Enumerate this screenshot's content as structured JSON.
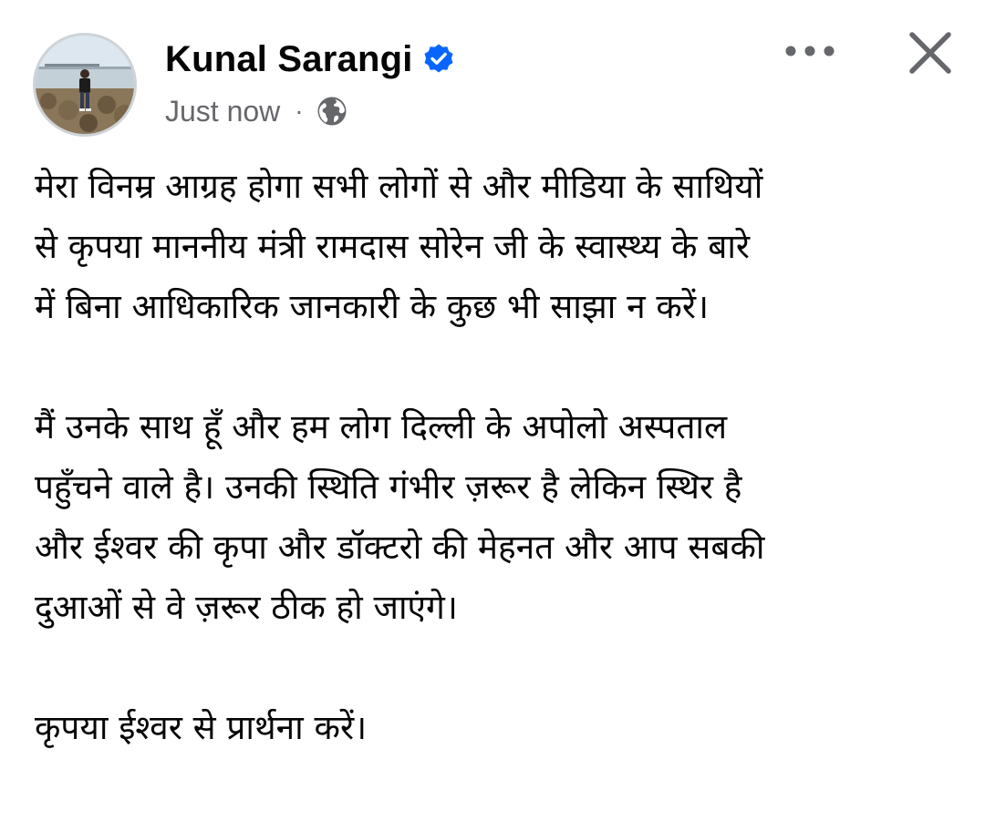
{
  "post": {
    "author": {
      "name": "Kunal Sarangi",
      "verified": true,
      "avatar_icon": "profile-photo"
    },
    "meta": {
      "timestamp": "Just now",
      "separator": "·",
      "privacy_icon": "globe-icon"
    },
    "actions": {
      "more_icon": "more-horizontal-icon",
      "close_icon": "close-icon"
    },
    "body": {
      "paragraphs": [
        {
          "lines": [
            "मेरा विनम्र आग्रह होगा सभी लोगों से और मीडिया के साथियों",
            "से कृपया माननीय मंत्री रामदास सोरेन जी के स्वास्थ्य के बारे",
            "में बिना आधिकारिक जानकारी के कुछ भी साझा न करें।"
          ]
        },
        {
          "lines": [
            "मैं उनके साथ हूँ और हम लोग दिल्ली के अपोलो अस्पताल",
            "पहुँचने वाले है। उनकी स्थिति गंभीर ज़रूर है लेकिन स्थिर है",
            "और ईश्वर की कृपा और डॉक्टरो की मेहनत और आप सबकी",
            "दुआओं से वे ज़रूर ठीक हो जाएंगे।"
          ]
        },
        {
          "lines": [
            "कृपया ईश्वर से प्रार्थना करें।"
          ]
        }
      ]
    },
    "colors": {
      "text_primary": "#050505",
      "text_secondary": "#65676b",
      "verified_blue": "#0866ff",
      "background": "#ffffff"
    }
  }
}
